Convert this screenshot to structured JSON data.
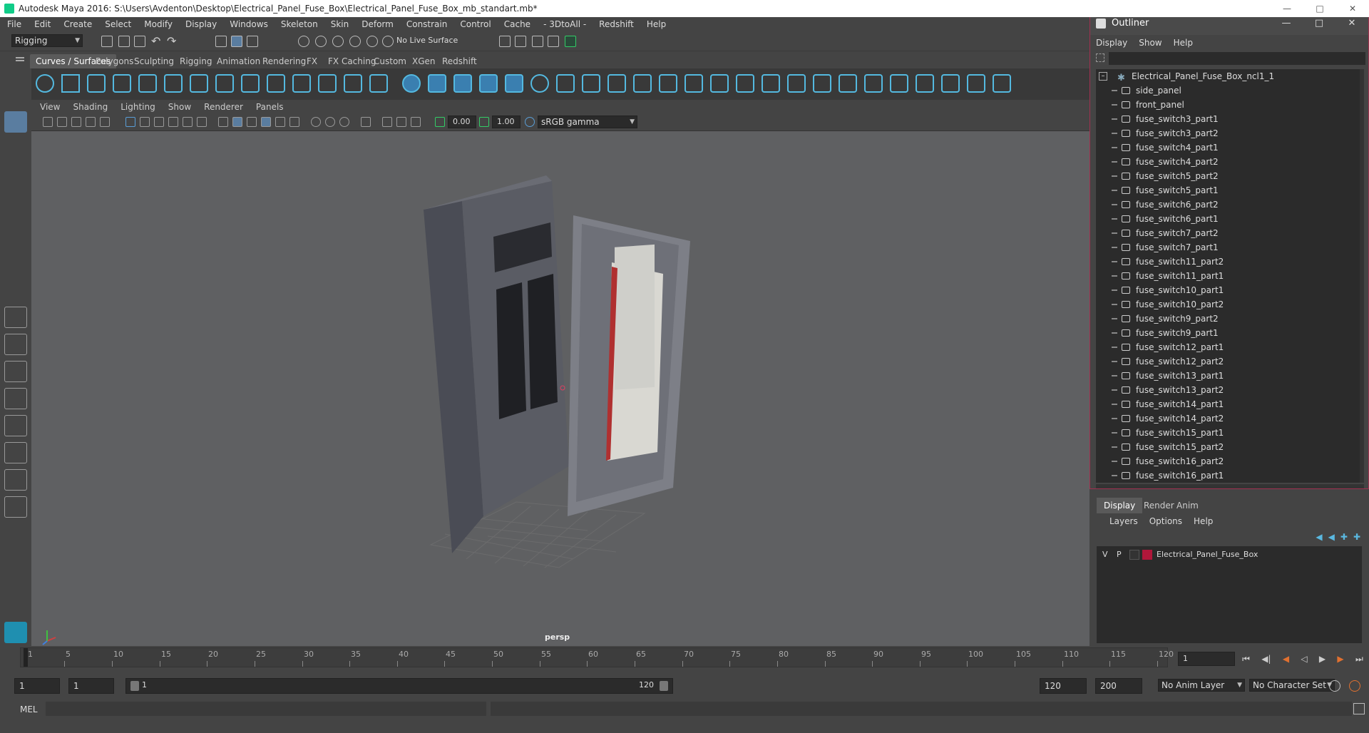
{
  "window": {
    "title": "Autodesk Maya 2016: S:\\Users\\Avdenton\\Desktop\\Electrical_Panel_Fuse_Box\\Electrical_Panel_Fuse_Box_mb_standart.mb*"
  },
  "menubar": [
    "File",
    "Edit",
    "Create",
    "Select",
    "Modify",
    "Display",
    "Windows",
    "Skeleton",
    "Skin",
    "Deform",
    "Constrain",
    "Control",
    "Cache",
    "- 3DtoAll -",
    "Redshift",
    "Help"
  ],
  "statusline": {
    "mode": "Rigging",
    "live_surface": "No Live Surface"
  },
  "shelf_tabs": [
    "Curves / Surfaces",
    "Polygons",
    "Sculpting",
    "Rigging",
    "Animation",
    "Rendering",
    "FX",
    "FX Caching",
    "Custom",
    "XGen",
    "Redshift"
  ],
  "shelf_active": "Curves / Surfaces",
  "panel_menu": [
    "View",
    "Shading",
    "Lighting",
    "Show",
    "Renderer",
    "Panels"
  ],
  "panel_toolbar": {
    "exposure": "0.00",
    "gamma": "1.00",
    "color_space": "sRGB gamma"
  },
  "viewport": {
    "camera": "persp"
  },
  "timeline": {
    "ticks": [
      "1",
      "5",
      "10",
      "15",
      "20",
      "25",
      "30",
      "35",
      "40",
      "45",
      "50",
      "55",
      "60",
      "65",
      "70",
      "75",
      "80",
      "85",
      "90",
      "95",
      "100",
      "105",
      "110",
      "115",
      "120"
    ],
    "current_frame": "1"
  },
  "range": {
    "start": "1",
    "anim_start": "1",
    "slider_start": "1",
    "slider_end": "120",
    "anim_end": "120",
    "end": "200",
    "anim_layer": "No Anim Layer",
    "char_set": "No Character Set"
  },
  "cmdline": {
    "label": "MEL"
  },
  "outliner": {
    "title": "Outliner",
    "menu": [
      "Display",
      "Show",
      "Help"
    ],
    "root": "Electrical_Panel_Fuse_Box_ncl1_1",
    "items": [
      "side_panel",
      "front_panel",
      "fuse_switch3_part1",
      "fuse_switch3_part2",
      "fuse_switch4_part1",
      "fuse_switch4_part2",
      "fuse_switch5_part2",
      "fuse_switch5_part1",
      "fuse_switch6_part2",
      "fuse_switch6_part1",
      "fuse_switch7_part2",
      "fuse_switch7_part1",
      "fuse_switch11_part2",
      "fuse_switch11_part1",
      "fuse_switch10_part1",
      "fuse_switch10_part2",
      "fuse_switch9_part2",
      "fuse_switch9_part1",
      "fuse_switch12_part1",
      "fuse_switch12_part2",
      "fuse_switch13_part1",
      "fuse_switch13_part2",
      "fuse_switch14_part1",
      "fuse_switch14_part2",
      "fuse_switch15_part1",
      "fuse_switch15_part2",
      "fuse_switch16_part2",
      "fuse_switch16_part1"
    ]
  },
  "layers": {
    "tabs": [
      "Display",
      "Render",
      "Anim"
    ],
    "menu": [
      "Layers",
      "Options",
      "Help"
    ],
    "layer": {
      "v": "V",
      "p": "P",
      "name": "Electrical_Panel_Fuse_Box",
      "color": "#b0173a"
    }
  }
}
